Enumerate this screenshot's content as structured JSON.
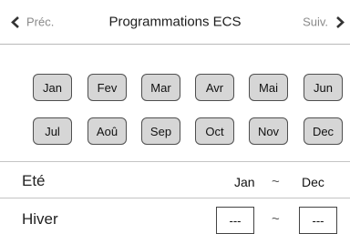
{
  "header": {
    "prev_label": "Préc.",
    "title": "Programmations ECS",
    "next_label": "Suiv."
  },
  "months": [
    {
      "label": "Jan"
    },
    {
      "label": "Fev"
    },
    {
      "label": "Mar"
    },
    {
      "label": "Avr"
    },
    {
      "label": "Mai"
    },
    {
      "label": "Jun"
    },
    {
      "label": "Jul"
    },
    {
      "label": "Aoû"
    },
    {
      "label": "Sep"
    },
    {
      "label": "Oct"
    },
    {
      "label": "Nov"
    },
    {
      "label": "Dec"
    }
  ],
  "summer": {
    "label": "Eté",
    "start": "Jan",
    "separator": "~",
    "end": "Dec"
  },
  "winter": {
    "label": "Hiver",
    "start": "---",
    "separator": "~",
    "end": "---"
  },
  "colors": {
    "button_fill": "#d6d6d6",
    "button_border": "#4f4f4f",
    "nav_text": "#8a8a8a"
  }
}
